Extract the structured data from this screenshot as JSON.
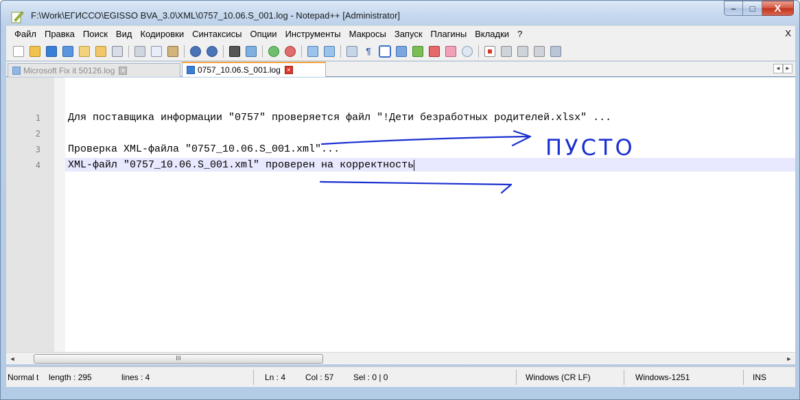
{
  "window": {
    "title": "F:\\Work\\ЕГИССО\\EGISSO BVA_3.0\\XML\\0757_10.06.S_001.log - Notepad++ [Administrator]",
    "controls": {
      "minimize": "–",
      "maximize": "□",
      "close": "X"
    }
  },
  "menu": {
    "items": [
      "Файл",
      "Правка",
      "Поиск",
      "Вид",
      "Кодировки",
      "Синтаксисы",
      "Опции",
      "Инструменты",
      "Макросы",
      "Запуск",
      "Плагины",
      "Вкладки",
      "?"
    ],
    "close_label": "X"
  },
  "toolbar": {
    "icons": [
      "new-file-icon",
      "open-file-icon",
      "save-icon",
      "save-all-icon",
      "close-icon",
      "close-all-icon",
      "print-icon",
      "cut-icon",
      "copy-icon",
      "paste-icon",
      "undo-icon",
      "redo-icon",
      "find-icon",
      "replace-icon",
      "zoom-in-icon",
      "zoom-out-icon",
      "sync-vertical-icon",
      "sync-horizontal-icon",
      "word-wrap-icon",
      "show-all-chars-icon",
      "indent-guide-icon",
      "doc-map-icon",
      "function-list-icon",
      "folder-as-workspace-icon",
      "doc-list-icon",
      "monitor-icon",
      "record-macro-icon",
      "stop-record-icon",
      "play-macro-icon",
      "run-macro-multiple-icon",
      "save-macro-icon"
    ]
  },
  "tabs": [
    {
      "label": "Microsoft Fix it 50126.log",
      "active": false
    },
    {
      "label": "0757_10.06.S_001.log",
      "active": true
    }
  ],
  "editor": {
    "lines": [
      {
        "no": "1",
        "text": "Для поставщика информации \"0757\" проверяется файл \"!Дети безработных родителей.xlsx\" ..."
      },
      {
        "no": "2",
        "text": ""
      },
      {
        "no": "3",
        "text": "Проверка XML-файла \"0757_10.06.S_001.xml\"..."
      },
      {
        "no": "4",
        "text": "XML-файл \"0757_10.06.S_001.xml\" проверен на корректность"
      }
    ],
    "annotation_text": "ПУСТО"
  },
  "scrollbar": {
    "left": "◄",
    "right": "►",
    "thumb": "III"
  },
  "status": {
    "mode": "Normal t",
    "length": "length : 295",
    "lines": "lines : 4",
    "ln": "Ln : 4",
    "col": "Col : 57",
    "sel": "Sel : 0 | 0",
    "eol": "Windows (CR LF)",
    "encoding": "Windows-1251",
    "ins": "INS"
  },
  "colors": {
    "accent_tab": "#f9a23b",
    "annotation_ink": "#1a2fd1",
    "current_line": "#e8e8ff"
  }
}
